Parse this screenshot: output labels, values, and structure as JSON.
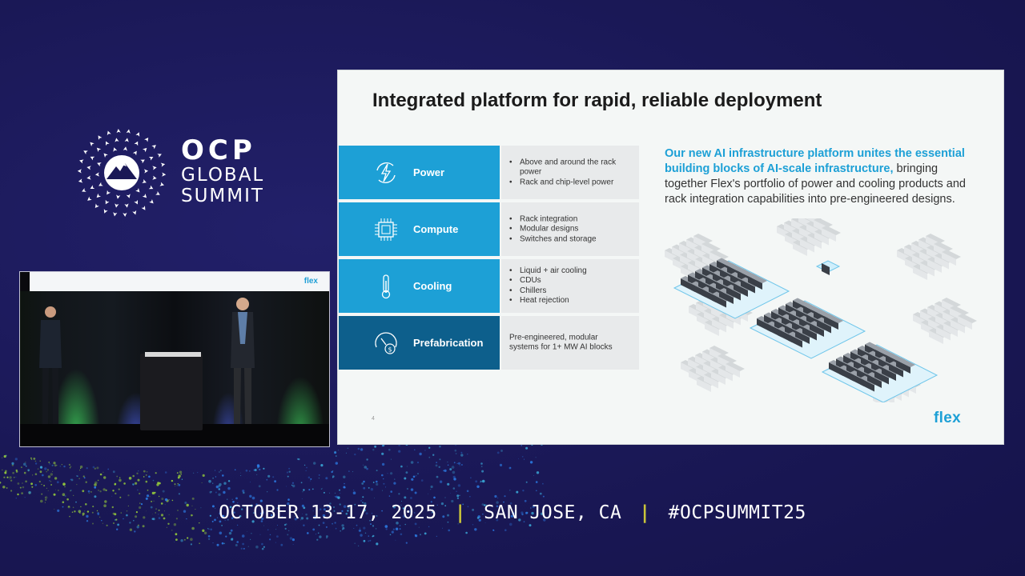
{
  "event": {
    "logo": {
      "line1": "OCP",
      "line2": "GLOBAL",
      "line3": "SUMMIT",
      "icon": "ocp-mountain-emblem-icon"
    },
    "banner": {
      "dates": "OCTOBER 13-17, 2025",
      "location": "SAN JOSE, CA",
      "hashtag": "#OCPSUMMIT25",
      "separator": "|"
    }
  },
  "camera": {
    "screen_logo": "flex"
  },
  "slide": {
    "title": "Integrated platform for rapid, reliable deployment",
    "rows": [
      {
        "label": "Power",
        "icon": "lightning-cycle-icon",
        "items": [
          "Above and around the rack power",
          "Rack and chip-level power"
        ]
      },
      {
        "label": "Compute",
        "icon": "chip-icon",
        "items": [
          "Rack integration",
          "Modular designs",
          "Switches and storage"
        ]
      },
      {
        "label": "Cooling",
        "icon": "thermometer-icon",
        "items": [
          "Liquid + air cooling",
          "CDUs",
          "Chillers",
          "Heat rejection"
        ]
      },
      {
        "label": "Prefabrication",
        "icon": "gauge-dollar-icon",
        "text": "Pre-engineered, modular systems for 1+ MW AI blocks"
      }
    ],
    "intro_highlight": "Our new AI infrastructure platform unites the essential building blocks of AI-scale infrastructure,",
    "intro_body": " bringing together Flex's portfolio of power and cooling products and rack integration capabilities into pre-engineered designs.",
    "page_number": "4",
    "logo": "flex",
    "accent_color": "#1da0d6",
    "dark_accent_color": "#0d5f8c"
  }
}
